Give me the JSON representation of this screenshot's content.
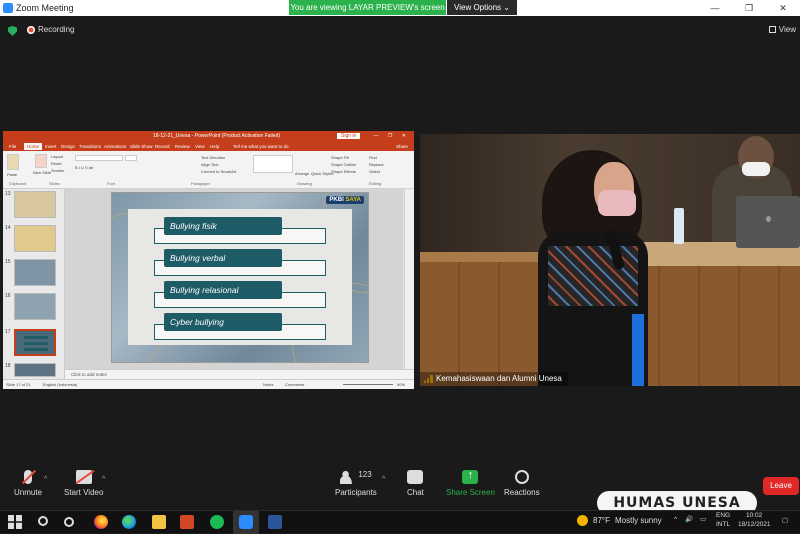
{
  "window": {
    "title": "Zoom Meeting",
    "controls": [
      "—",
      "❐",
      "✕"
    ]
  },
  "banner": {
    "viewing_text": "You are viewing LAYAR PREVIEW's screen",
    "view_options": "View Options ⌄"
  },
  "status": {
    "recording": "Recording",
    "view": "View"
  },
  "powerpoint": {
    "title": "18-12-21_Unesa - PowerPoint (Product Activation Failed)",
    "signin": "Sign in",
    "tabs": [
      "File",
      "Home",
      "Insert",
      "Design",
      "Transitions",
      "Animations",
      "Slide Show",
      "Record",
      "Review",
      "View",
      "Help"
    ],
    "tell_me": "Tell me what you want to do",
    "share": "Share",
    "groups": [
      "Clipboard",
      "Slides",
      "Font",
      "Paragraph",
      "Drawing",
      "Editing"
    ],
    "ribbon_labels": {
      "paste": "Paste",
      "new_slide": "New Slide",
      "layout": "Layout",
      "reset": "Reset",
      "section": "Section",
      "arrange": "Arrange",
      "quick_styles": "Quick Styles",
      "find": "Find",
      "replace": "Replace",
      "select": "Select",
      "text_direction": "Text Direction",
      "align_text": "Align Text",
      "convert_smartart": "Convert to SmartArt",
      "shape_fill": "Shape Fill",
      "shape_outline": "Shape Outline",
      "shape_effects": "Shape Effects"
    },
    "thumb_numbers": [
      "13",
      "14",
      "15",
      "16",
      "17",
      "18"
    ],
    "slide_items": [
      "Bullying fisik",
      "Bullying verbal",
      "Bullying relasional",
      "Cyber bullying"
    ],
    "logo_main": "PKBI",
    "logo_sub": "SAYA",
    "notes": "Click to add notes",
    "status_slide": "Slide 17 of 21",
    "status_lang": "English (Indonesia)",
    "status_notes": "Notes",
    "status_comments": "Comments",
    "zoom": "90%"
  },
  "video": {
    "participant_name": "Kemahasiswaan dan Alumni Unesa"
  },
  "toolbar": {
    "unmute": "Unmute",
    "start_video": "Start Video",
    "participants": "Participants",
    "participants_count": "123",
    "chat": "Chat",
    "share_screen": "Share Screen",
    "reactions": "Reactions",
    "leave": "Leave"
  },
  "watermark": "HUMAS UNESA",
  "taskbar": {
    "temperature": "87°F",
    "weather": "Mostly sunny",
    "lang1": "ENG",
    "lang2": "INTL",
    "time": "10:02",
    "date": "18/12/2021"
  },
  "colors": {
    "zoom_green": "#2bb24c",
    "leave_red": "#e02828",
    "ppt_red": "#c43e1c",
    "slide_pill": "#1d5b66"
  }
}
